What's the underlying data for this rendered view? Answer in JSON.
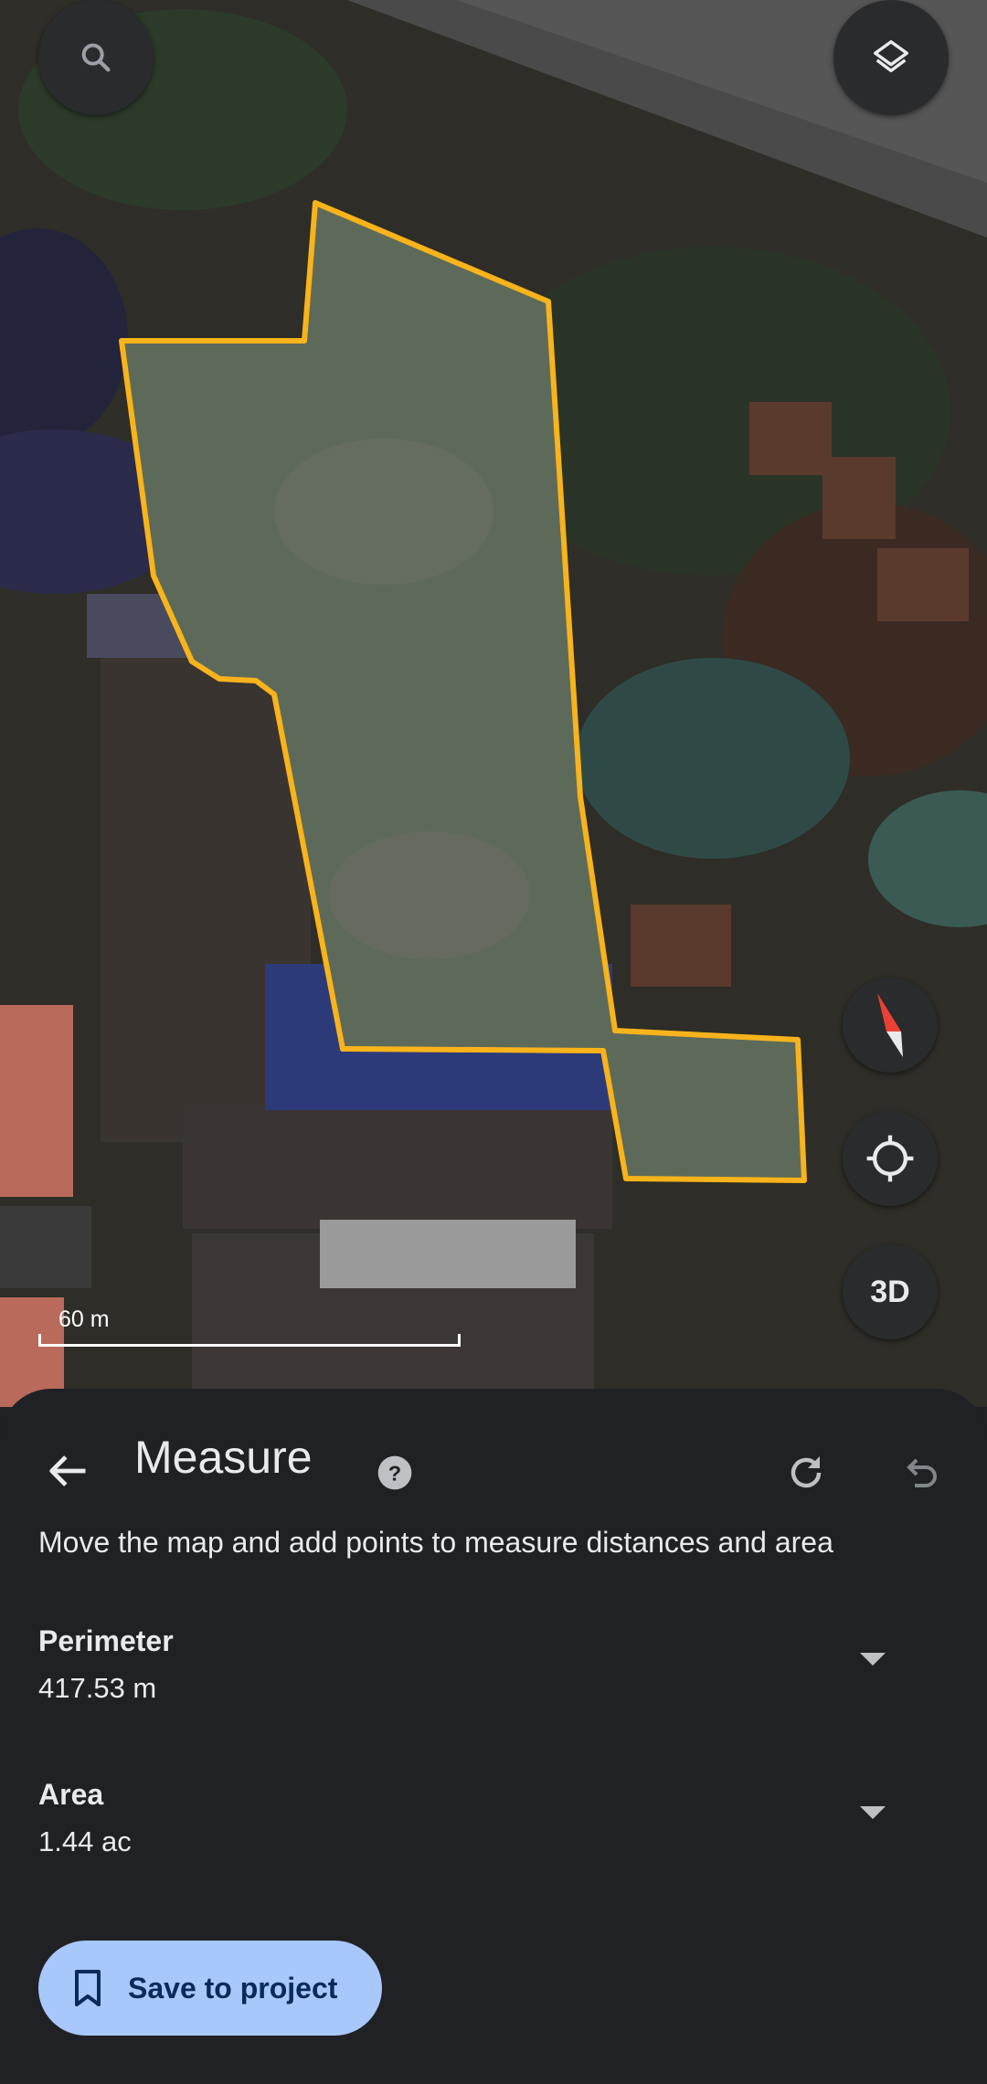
{
  "map": {
    "scale_label": "60 m",
    "button_3d_label": "3D",
    "outline_color": "#f9b31b"
  },
  "sheet": {
    "title": "Measure",
    "instructions": "Move the map and add points to measure distances and area",
    "perimeter": {
      "label": "Perimeter",
      "value": "417.53 m"
    },
    "area": {
      "label": "Area",
      "value": "1.44 ac"
    },
    "save_label": "Save to project"
  },
  "colors": {
    "sheet_bg": "#202124",
    "save_button_bg": "#a8c7fa",
    "compass_red": "#e94235"
  },
  "icons": [
    "search-icon",
    "layers-icon",
    "compass-icon",
    "my-location-icon",
    "back-arrow-icon",
    "help-icon",
    "redo-icon",
    "undo-icon",
    "chevron-down-icon",
    "bookmark-icon"
  ]
}
